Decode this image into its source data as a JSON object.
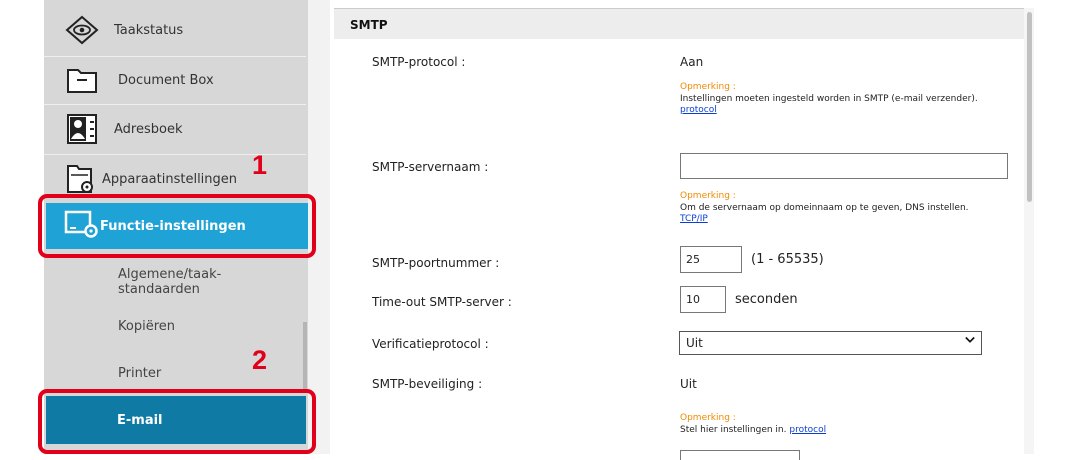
{
  "sidebar": {
    "items": [
      {
        "label": "Taakstatus",
        "icon": "eye-diamond-icon"
      },
      {
        "label": "Document Box",
        "icon": "folder-box-icon"
      },
      {
        "label": "Adresboek",
        "icon": "address-book-icon"
      },
      {
        "label": "Apparaatinstellingen",
        "icon": "folder-gear-icon"
      },
      {
        "label": "Functie-instellingen",
        "icon": "monitor-gear-icon"
      }
    ],
    "subitems": [
      "Algemene/taak-\nstandaarden",
      "Kopiëren",
      "Printer",
      "E-mail"
    ]
  },
  "callouts": [
    "1",
    "2"
  ],
  "section": {
    "title": "SMTP"
  },
  "fields": {
    "smtp_protocol": {
      "label": "SMTP-protocol :",
      "value": "Aan"
    },
    "note1": {
      "title": "Opmerking :",
      "text": "Instellingen moeten ingesteld worden in SMTP (e-mail verzender).",
      "link": "protocol"
    },
    "servername": {
      "label": "SMTP-servernaam :",
      "value": ""
    },
    "note2": {
      "title": "Opmerking :",
      "text": "Om de servernaam op domeinnaam op te geven, DNS instellen.",
      "link": "TCP/IP"
    },
    "port": {
      "label": "SMTP-poortnummer :",
      "value": "25",
      "range": "(1 - 65535)"
    },
    "timeout": {
      "label": "Time-out SMTP-server :",
      "value": "10",
      "unit": "seconden"
    },
    "auth": {
      "label": "Verificatieprotocol :",
      "value": "Uit"
    },
    "security": {
      "label": "SMTP-beveiliging :",
      "value": "Uit"
    },
    "note3": {
      "title": "Opmerking :",
      "text": "Stel hier instellingen in.",
      "link": "protocol"
    }
  },
  "colors": {
    "active": "#1fa2d6",
    "active_dark": "#0f7aa3",
    "callout": "#e1001a",
    "note": "#f08a00",
    "link": "#0b3fd4"
  }
}
